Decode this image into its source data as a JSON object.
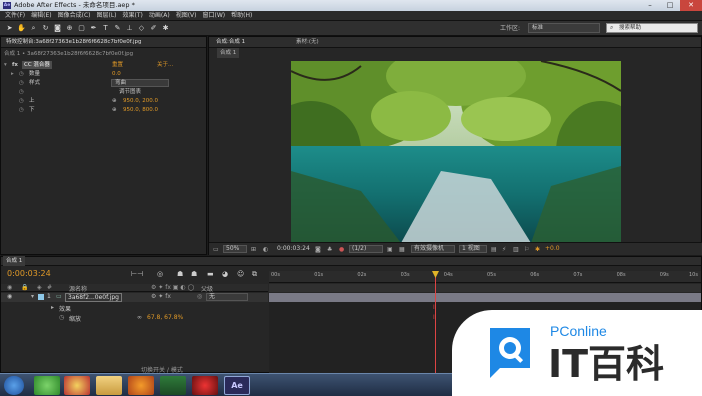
{
  "window": {
    "title": "Adobe After Effects - 未命名项目.aep *"
  },
  "menu": [
    "文件(F)",
    "编辑(E)",
    "图像合成(C)",
    "图层(L)",
    "效果(T)",
    "动画(A)",
    "视图(V)",
    "窗口(W)",
    "帮助(H)"
  ],
  "toolbar": {
    "workspace_label": "工作区:",
    "workspace_value": "标准",
    "search_placeholder": "搜索帮助"
  },
  "effects_panel": {
    "tab": "特效控制台:3a68f27363e1b28f6f6628c7bf0e0f.jpg",
    "header": "合成 1 • 3a68f27363e1b28f6f6628c7bf0e0f.jpg",
    "effect_name": "CC 混合器",
    "reset": "重置",
    "about": "关于...",
    "rows": [
      {
        "label": "数量",
        "value": "0.0"
      },
      {
        "label": "样式",
        "value": "弯曲"
      },
      {
        "label": "",
        "value": "调节图表"
      },
      {
        "label": "上",
        "value": "950.0, 200.0"
      },
      {
        "label": "下",
        "value": "950.0, 800.0"
      }
    ]
  },
  "viewer": {
    "tab": "合成:合成 1",
    "footage_tab": "素材:(无)",
    "subtab": "合成 1",
    "zoom": "50%",
    "timecode": "0:00:03:24",
    "resolution": "(1/2)",
    "camera": "有效摄像机",
    "views": "1 视图",
    "exposure": "+0.0"
  },
  "timeline": {
    "tab": "合成 1",
    "timecode": "0:00:03:24",
    "col_source": "源名称",
    "col_parent": "父级",
    "layer_index": "1",
    "layer_name": "3a68f2...0e0f.jpg",
    "parent_value": "无",
    "effects_label": "效果",
    "scale_label": "缩放",
    "scale_value": "67.8, 67.8%",
    "ruler": [
      "00s",
      "01s",
      "02s",
      "03s",
      "04s",
      "05s",
      "06s",
      "07s",
      "08s",
      "09s",
      "10s"
    ],
    "footer": "切换开关 / 模式"
  },
  "watermark": {
    "brand": "PConline",
    "name": "IT百科",
    "colors": {
      "blue": "#1e88e5",
      "dark": "#2b2b2b"
    }
  },
  "taskbar": {
    "ae_label": "Ae"
  }
}
